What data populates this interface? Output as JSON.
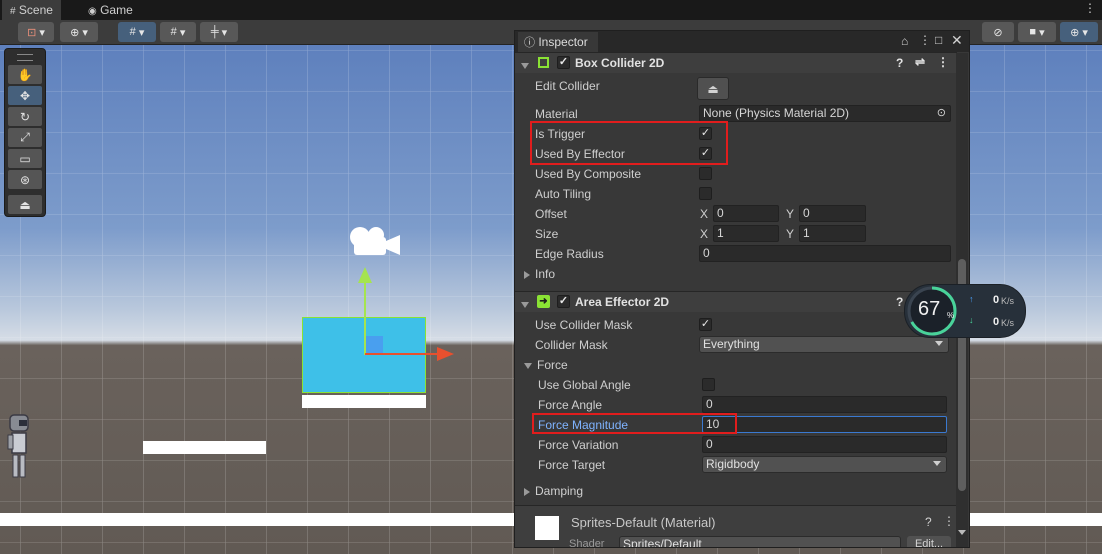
{
  "tabs": [
    {
      "label": "Scene",
      "icon": "grid-icon"
    },
    {
      "label": "Game",
      "icon": "gamepad-icon"
    }
  ],
  "inspector": {
    "title": "Inspector",
    "box_collider": {
      "title": "Box Collider 2D",
      "edit_collider_label": "Edit Collider",
      "material_label": "Material",
      "material_value": "None (Physics Material 2D)",
      "is_trigger_label": "Is Trigger",
      "used_by_effector_label": "Used By Effector",
      "used_by_composite_label": "Used By Composite",
      "auto_tiling_label": "Auto Tiling",
      "offset_label": "Offset",
      "offset": {
        "x": "0",
        "y": "0"
      },
      "size_label": "Size",
      "size": {
        "x": "1",
        "y": "1"
      },
      "edge_radius_label": "Edge Radius",
      "edge_radius": "0",
      "info_label": "Info",
      "axis_x": "X",
      "axis_y": "Y"
    },
    "area_effector": {
      "title": "Area Effector 2D",
      "use_collider_mask_label": "Use Collider Mask",
      "collider_mask_label": "Collider Mask",
      "collider_mask_value": "Everything",
      "force_label": "Force",
      "use_global_angle_label": "Use Global Angle",
      "force_angle_label": "Force Angle",
      "force_angle": "0",
      "force_magnitude_label": "Force Magnitude",
      "force_magnitude": "10",
      "force_variation_label": "Force Variation",
      "force_variation": "0",
      "force_target_label": "Force Target",
      "force_target_value": "Rigidbody",
      "damping_label": "Damping"
    },
    "material": {
      "title": "Sprites-Default (Material)",
      "shader_label": "Shader",
      "shader_value": "Sprites/Default",
      "edit_label": "Edit..."
    }
  },
  "network_monitor": {
    "percent": "67",
    "percent_unit": "%",
    "upload": "0",
    "download": "0",
    "unit": "K/s",
    "ring_fraction": 0.67
  },
  "colors": {
    "accent": "#46607c",
    "highlight_red": "#e11d1d",
    "selection_blue": "#3ec0e8",
    "component_green": "#8ae234"
  }
}
